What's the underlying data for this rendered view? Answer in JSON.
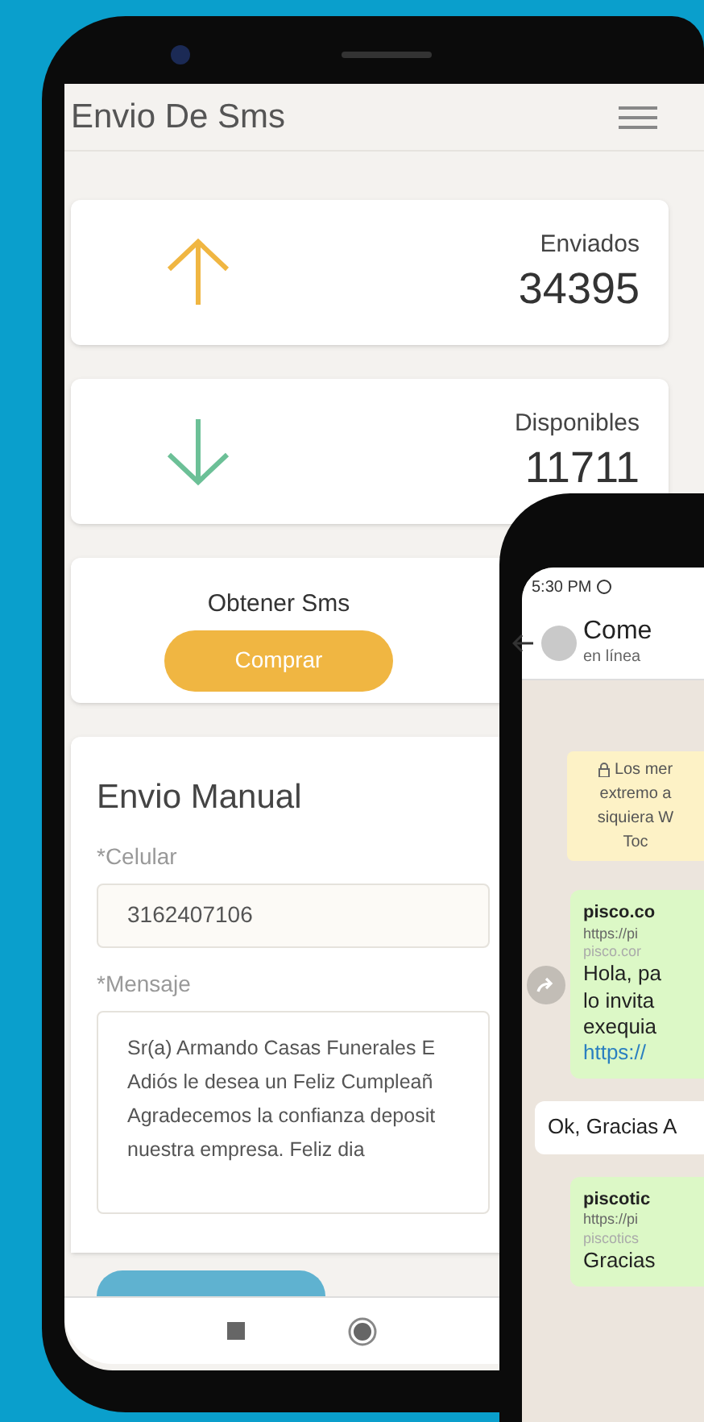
{
  "app": {
    "title": "Envio De Sms"
  },
  "stats": [
    {
      "kind": "up",
      "label": "Enviados",
      "value": "34395"
    },
    {
      "kind": "down",
      "label": "Disponibles",
      "value": "11711"
    }
  ],
  "purchase": {
    "title": "Obtener Sms",
    "button": "Comprar"
  },
  "manual": {
    "title": "Envio Manual",
    "phone_label": "*Celular",
    "phone_value": "3162407106",
    "message_label": "*Mensaje",
    "message_lines": [
      "Sr(a) Armando Casas Funerales E",
      "Adiós le desea un Feliz Cumpleañ",
      "Agradecemos la confianza deposit",
      "nuestra empresa. Feliz dia"
    ]
  },
  "chat": {
    "status_time": "5:30 PM",
    "contact": "Come",
    "presence": "en línea",
    "notice_lines": [
      "Los mer",
      "extremo a",
      "siquiera W",
      "Toc"
    ],
    "messages": [
      {
        "outgoing": true,
        "forward_button": true,
        "parts": [
          {
            "kind": "title",
            "text": "pisco.co"
          },
          {
            "kind": "url",
            "text": "https://pi"
          },
          {
            "kind": "domain",
            "text": "pisco.cor"
          },
          {
            "kind": "text",
            "text": "Hola, pa"
          },
          {
            "kind": "text",
            "text": "lo invita"
          },
          {
            "kind": "text",
            "text": "exequia"
          },
          {
            "kind": "link",
            "text": "https://"
          }
        ]
      },
      {
        "outgoing": false,
        "forward_button": false,
        "parts": [
          {
            "kind": "text",
            "text": "Ok, Gracias A"
          }
        ]
      },
      {
        "outgoing": true,
        "forward_button": false,
        "parts": [
          {
            "kind": "title",
            "text": "piscotic"
          },
          {
            "kind": "url",
            "text": "https://pi"
          },
          {
            "kind": "domain",
            "text": "piscotics"
          },
          {
            "kind": "text",
            "text": "Gracias"
          }
        ]
      }
    ]
  }
}
